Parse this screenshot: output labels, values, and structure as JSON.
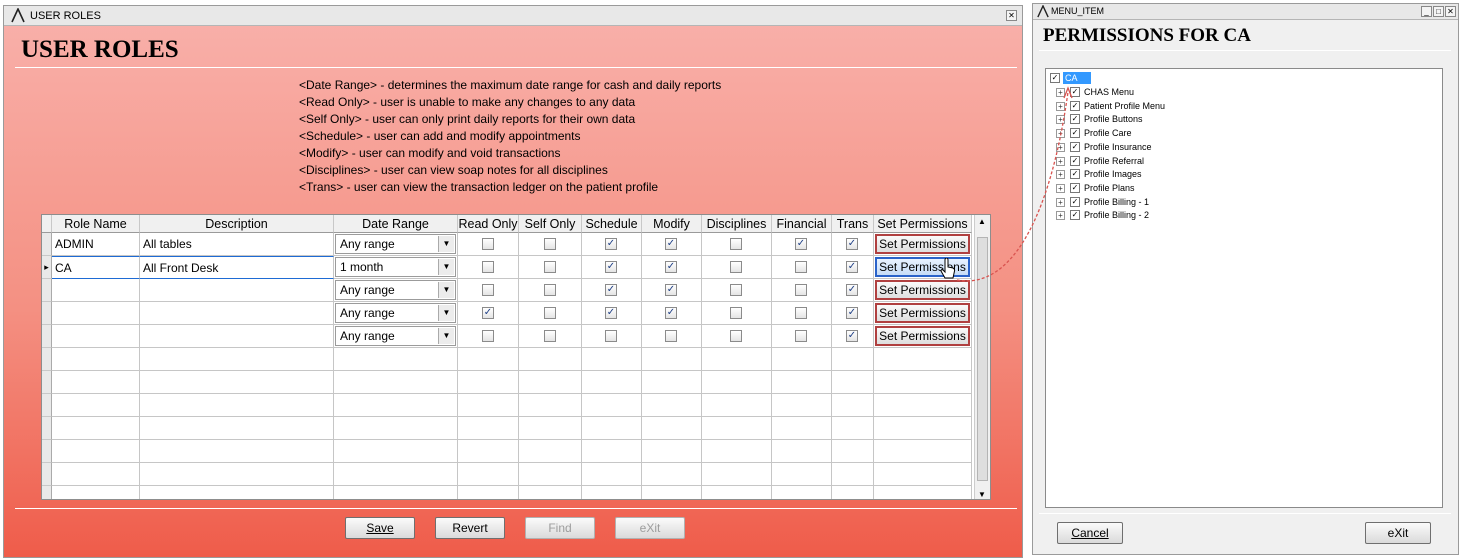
{
  "main_window": {
    "title": "USER ROLES",
    "heading": "USER ROLES",
    "descriptions": [
      "<Date Range> - determines the maximum date range for cash and daily reports",
      "<Read Only> - user is unable to make any changes to any data",
      "<Self Only> - user can only print daily reports for their own data",
      "<Schedule> - user can add and modify appointments",
      "<Modify> - user can modify and void transactions",
      "<Disciplines> - user can view soap notes for all disciplines",
      "<Trans> - user can view the transaction ledger on the patient profile"
    ],
    "columns": [
      "Role Name",
      "Description",
      "Date Range",
      "Read Only",
      "Self Only",
      "Schedule",
      "Modify",
      "Disciplines",
      "Financial",
      "Trans",
      "Set Permissions"
    ],
    "rows": [
      {
        "role": "ADMIN",
        "description": "All tables",
        "date_range": "Any range",
        "read_only": false,
        "self_only": false,
        "schedule": true,
        "modify": true,
        "disciplines": false,
        "financial": true,
        "trans": true,
        "button": "Set Permissions"
      },
      {
        "role": "CA",
        "description": "All Front Desk",
        "date_range": "1 month",
        "read_only": false,
        "self_only": false,
        "schedule": true,
        "modify": true,
        "disciplines": false,
        "financial": false,
        "trans": true,
        "button": "Set Permissions"
      },
      {
        "role": "",
        "description": "",
        "date_range": "Any range",
        "read_only": false,
        "self_only": false,
        "schedule": true,
        "modify": true,
        "disciplines": false,
        "financial": false,
        "trans": true,
        "button": "Set Permissions"
      },
      {
        "role": "",
        "description": "",
        "date_range": "Any range",
        "read_only": true,
        "self_only": false,
        "schedule": true,
        "modify": true,
        "disciplines": false,
        "financial": false,
        "trans": true,
        "button": "Set Permissions"
      },
      {
        "role": "",
        "description": "",
        "date_range": "Any range",
        "read_only": false,
        "self_only": false,
        "schedule": false,
        "modify": false,
        "disciplines": false,
        "financial": false,
        "trans": true,
        "button": "Set Permissions"
      }
    ],
    "buttons": {
      "save": "Save",
      "revert": "Revert",
      "find": "Find",
      "exit": "eXit"
    }
  },
  "menu_window": {
    "title": "MENU_ITEM",
    "heading": "PERMISSIONS FOR CA",
    "root": "CA",
    "items": [
      "CHAS Menu",
      "Patient Profile Menu",
      "Profile Buttons",
      "Profile Care",
      "Profile Insurance",
      "Profile Referral",
      "Profile Images",
      "Profile Plans",
      "Profile Billing - 1",
      "Profile Billing - 2"
    ],
    "buttons": {
      "cancel": "Cancel",
      "exit": "eXit"
    }
  }
}
